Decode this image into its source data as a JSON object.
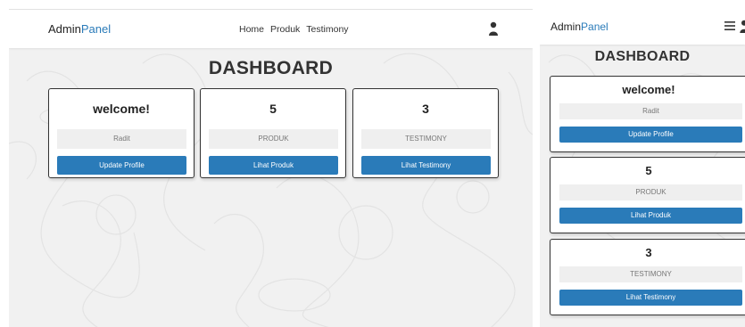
{
  "brand": {
    "text_a": "Admin",
    "text_b": "Panel"
  },
  "nav": {
    "links": [
      "Home",
      "Produk",
      "Testimony"
    ]
  },
  "dashboard": {
    "title": "DASHBOARD"
  },
  "cards": [
    {
      "heading": "welcome!",
      "sub": "Radit",
      "button": "Update Profile"
    },
    {
      "heading": "5",
      "sub": "PRODUK",
      "button": "Lihat Produk"
    },
    {
      "heading": "3",
      "sub": "TESTIMONY",
      "button": "Lihat Testimony"
    }
  ],
  "colors": {
    "accent": "#2a7bb9",
    "background": "#f1f1f1"
  },
  "icons": {
    "user": "user-icon",
    "menu": "hamburger-menu-icon"
  }
}
